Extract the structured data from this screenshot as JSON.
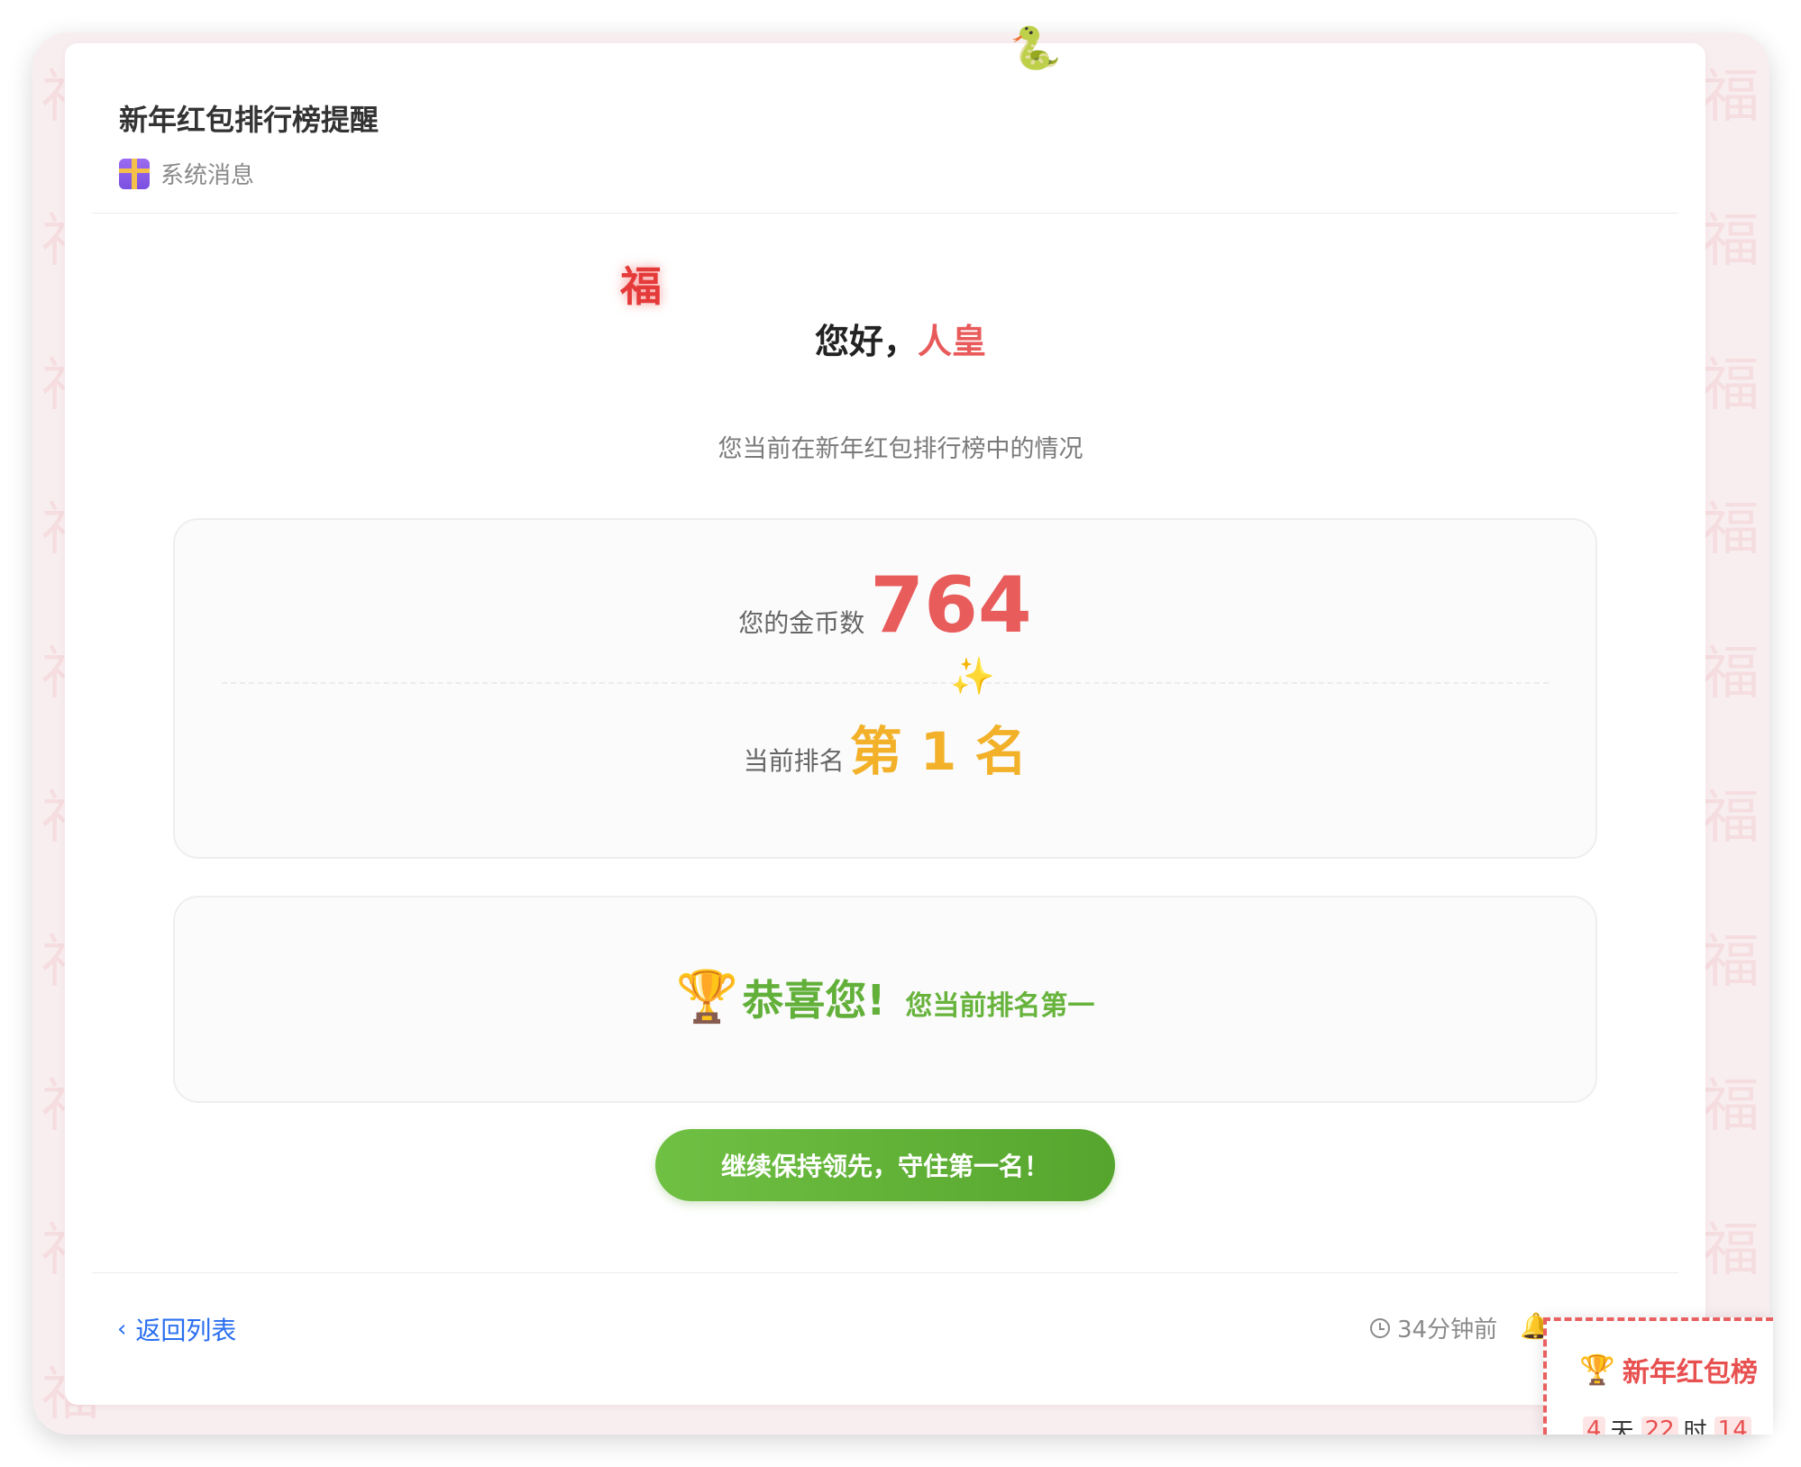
{
  "message": {
    "title": "新年红包排行榜提醒",
    "category": "系统消息",
    "decoration_char": "福"
  },
  "greeting": {
    "prefix": "您好，",
    "name": "人皇"
  },
  "subtitle": "您当前在新年红包排行榜中的情况",
  "stats": {
    "coins_label": "您的金币数",
    "coins_value": "764",
    "rank_label": "当前排名",
    "rank_value": "第 1 名"
  },
  "congrats": {
    "title": "恭喜您!",
    "subtitle": "您当前排名第一"
  },
  "cta": {
    "label": "继续保持领先，守住第一名！"
  },
  "footer": {
    "back_label": "返回列表",
    "time_ago": "34分钟前"
  },
  "countdown": {
    "title": "新年红包榜",
    "days": "4",
    "days_unit": "天",
    "hours": "22",
    "hours_unit": "时",
    "minutes": "14"
  },
  "icons": {
    "snake": "snake-icon",
    "gift": "gift-icon",
    "sparkle": "sparkle-icon",
    "trophy": "trophy-icon",
    "clock": "clock-icon",
    "bell": "bell-icon",
    "back": "chevron-left-icon"
  },
  "colors": {
    "accent_red": "#e85c5c",
    "rank_gold": "#f2b128",
    "success_green": "#62b03a",
    "link_blue": "#2a6ff0",
    "backdrop": "#f8eef0"
  }
}
